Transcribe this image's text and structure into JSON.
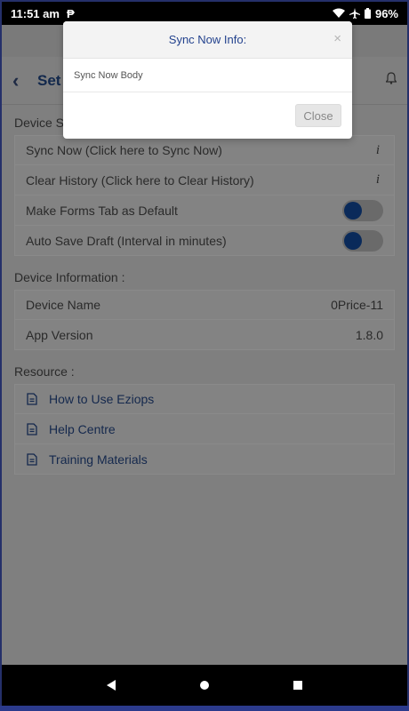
{
  "status_bar": {
    "time": "11:51 am",
    "battery": "96%",
    "icons": [
      "p-icon",
      "wifi-icon",
      "airplane-icon",
      "battery-icon"
    ]
  },
  "header": {
    "title": "Set",
    "back_icon": "chevron-left-icon",
    "bell_icon": "bell-icon"
  },
  "device_settings": {
    "label": "Device Se",
    "rows": [
      {
        "label": "Sync Now (Click here to Sync Now)",
        "info": "i"
      },
      {
        "label": "Clear History (Click here to Clear History)",
        "info": "i"
      },
      {
        "label": "Make Forms Tab as Default",
        "toggle": "off"
      },
      {
        "label": "Auto Save Draft (Interval in minutes)",
        "toggle": "off"
      }
    ]
  },
  "device_information": {
    "label": "Device Information :",
    "rows": [
      {
        "label": "Device Name",
        "value": "0Price-11"
      },
      {
        "label": "App Version",
        "value": "1.8.0"
      }
    ]
  },
  "resource": {
    "label": "Resource :",
    "items": [
      {
        "label": "How to Use Eziops"
      },
      {
        "label": "Help Centre"
      },
      {
        "label": "Training Materials"
      }
    ]
  },
  "modal": {
    "title": "Sync Now Info:",
    "close_x": "×",
    "body": "Sync Now Body",
    "close_label": "Close"
  },
  "colors": {
    "link": "#14284d",
    "toggle_knob": "#0a2a5a",
    "modal_title": "#24438e",
    "frame": "#25306a"
  }
}
